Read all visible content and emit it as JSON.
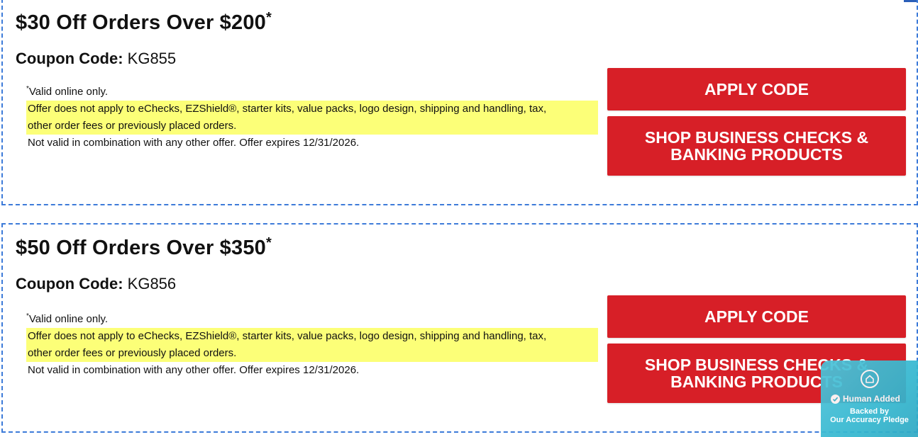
{
  "coupons": [
    {
      "headline": "$30 Off Orders Over $200",
      "headline_asterisk": "*",
      "code_label": "Coupon Code:",
      "code": "KG855",
      "valid_asterisk": "*",
      "valid_text": "Valid online only.",
      "exclusion_line1": "Offer does not apply to eChecks, EZShield®, starter kits, value packs, logo design, shipping and handling, tax,",
      "exclusion_line2": "other order fees or previously placed orders.",
      "expiry_text": "Not valid in combination with any other offer. Offer expires 12/31/2026.",
      "apply_label": "APPLY CODE",
      "shop_label_line1": "SHOP BUSINESS CHECKS &",
      "shop_label_line2": "BANKING PRODUCTS"
    },
    {
      "headline": "$50 Off Orders Over $350",
      "headline_asterisk": "*",
      "code_label": "Coupon Code:",
      "code": "KG856",
      "valid_asterisk": "*",
      "valid_text": "Valid online only.",
      "exclusion_line1": "Offer does not apply to eChecks, EZShield®, starter kits, value packs, logo design, shipping and handling, tax,",
      "exclusion_line2": "other order fees or previously placed orders.",
      "expiry_text": "Not valid in combination with any other offer. Offer expires 12/31/2026.",
      "apply_label": "APPLY CODE",
      "shop_label_line1": "SHOP BUSINESS CHECKS &",
      "shop_label_line2": "BANKING PRODUCTS"
    }
  ],
  "pledge_badge": {
    "icon": "house-icon",
    "check_icon": "checkmark-icon",
    "title": "Human Added",
    "backed_line1": "Backed by",
    "backed_line2": "Our Accuracy Pledge"
  },
  "colors": {
    "button_red": "#d71f27",
    "dash_blue": "#3d7bd9",
    "highlight_yellow": "#fcff78",
    "badge_teal": "#35b8d0"
  }
}
